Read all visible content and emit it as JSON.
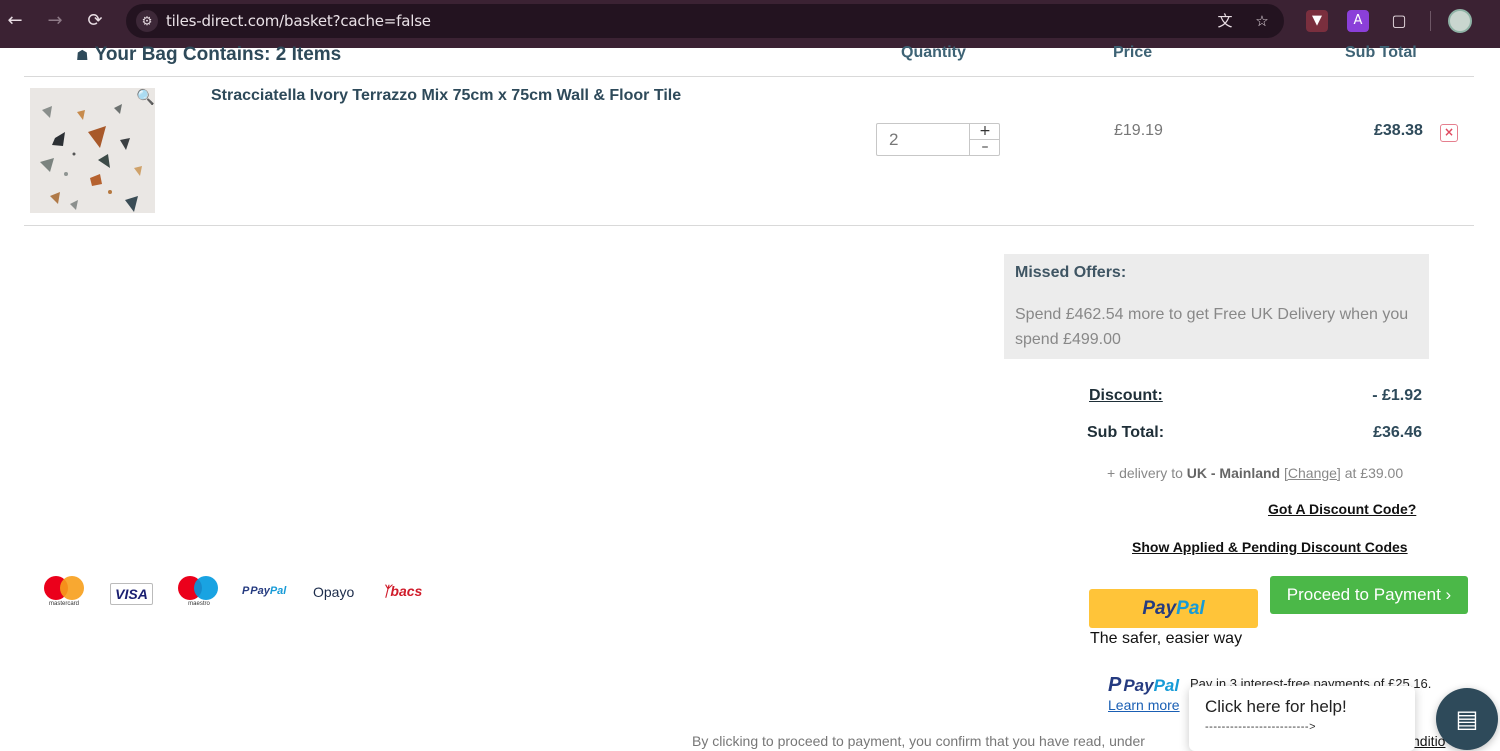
{
  "browser": {
    "url": "tiles-direct.com/basket?cache=false",
    "back_icon": "arrow-left-icon",
    "forward_icon": "arrow-right-icon",
    "reload_icon": "reload-icon"
  },
  "basket": {
    "title": "Your Bag Contains: 2 Items",
    "columns": {
      "quantity": "Quantity",
      "price": "Price",
      "subtotal": "Sub Total"
    }
  },
  "item": {
    "name": "Stracciatella Ivory Terrazzo Mix 75cm x 75cm Wall & Floor Tile",
    "quantity": "2",
    "price": "£19.19",
    "line_total": "£38.38"
  },
  "offers": {
    "title": "Missed Offers:",
    "text": "Spend £462.54 more to get Free UK Delivery when you spend £499.00"
  },
  "totals": {
    "discount_label": "Discount:",
    "discount_value": "- £1.92",
    "subtotal_label": "Sub Total:",
    "subtotal_value": "£36.46",
    "delivery_prefix": "+ delivery to ",
    "delivery_region": "UK - Mainland",
    "delivery_change": "[Change]",
    "delivery_suffix": " at £39.00"
  },
  "links": {
    "discount_code": "Got A Discount Code?",
    "show_codes": "Show Applied & Pending Discount Codes"
  },
  "payment_logos": {
    "mastercard": "mastercard",
    "visa": "VISA",
    "maestro": "maestro",
    "paypal_pay": "Pay",
    "paypal_pal": "Pal",
    "opayo": "Opayo",
    "bacs_mark": "̿",
    "bacs": "bacs"
  },
  "checkout": {
    "paypal_pay": "Pay",
    "paypal_pal": "Pal",
    "paypal_tagline": "The safer, easier way",
    "proceed": "Proceed to Payment ›",
    "paylater_pay": "Pay",
    "paylater_pal": "Pal",
    "paylater_text": "Pay in 3 interest-free payments of £25.16.",
    "learn_more": "Learn more",
    "terms": "By clicking to proceed to payment, you confirm that you have read, under",
    "terms_tail": "nditio"
  },
  "help": {
    "title": "Click here for help!",
    "arrow": "------------------------->"
  },
  "colors": {
    "accent": "#2e4a5a",
    "proceed": "#4bb848",
    "paypal_yellow": "#ffc439",
    "chrome": "#3b2233"
  }
}
